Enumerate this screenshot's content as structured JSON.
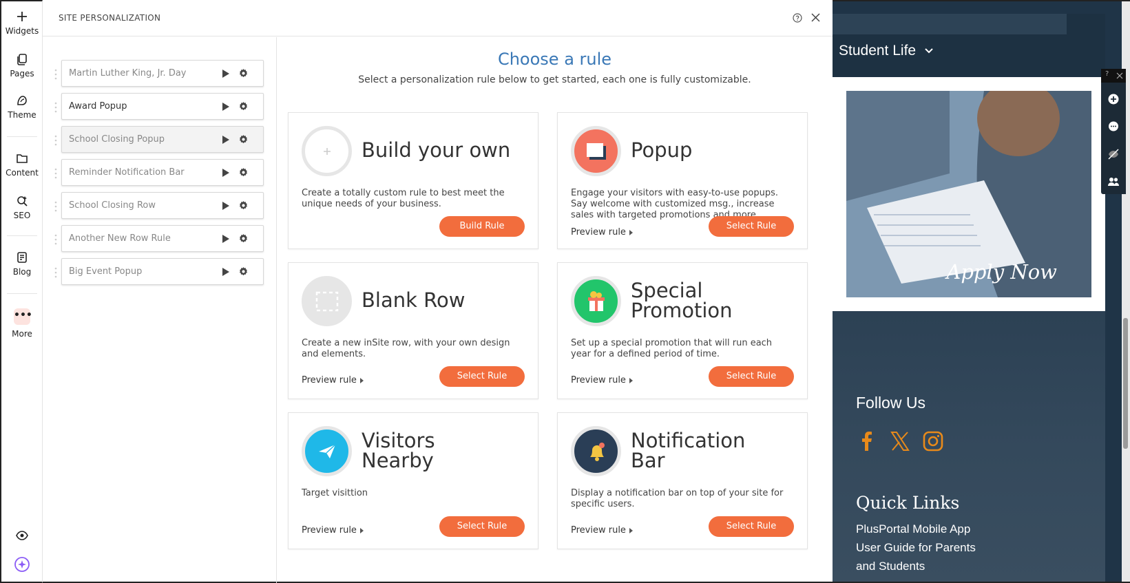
{
  "rail": {
    "items": [
      {
        "label": "Widgets",
        "icon": "plus-icon"
      },
      {
        "label": "Pages",
        "icon": "pages-icon"
      },
      {
        "label": "Theme",
        "icon": "theme-icon"
      },
      {
        "label": "Content",
        "icon": "folder-icon"
      },
      {
        "label": "SEO",
        "icon": "seo-icon"
      },
      {
        "label": "Blog",
        "icon": "blog-icon"
      },
      {
        "label": "More",
        "icon": "more-icon"
      }
    ]
  },
  "panel": {
    "title": "SITE PERSONALIZATION",
    "rules": [
      {
        "name": "Martin Luther King, Jr. Day"
      },
      {
        "name": "Award Popup"
      },
      {
        "name": "School Closing Popup"
      },
      {
        "name": "Reminder Notification Bar"
      },
      {
        "name": "School Closing Row"
      },
      {
        "name": "Another New Row Rule"
      },
      {
        "name": "Big Event Popup"
      }
    ],
    "heading": "Choose a rule",
    "subheading": "Select a personalization rule below to get started, each one is fully customizable.",
    "cards": [
      {
        "title": "Build your own",
        "desc": "Create a totally custom rule to best meet the unique needs of your business.",
        "button": "Build Rule",
        "preview": ""
      },
      {
        "title": "Popup",
        "desc": "Engage your visitors with easy-to-use popups. Say welcome with customized msg., increase sales with targeted promotions and more.",
        "button": "Select Rule",
        "preview": "Preview rule"
      },
      {
        "title": "Blank Row",
        "desc": "Create a new inSite row, with your own design and elements.",
        "button": "Select Rule",
        "preview": "Preview rule"
      },
      {
        "title": "Special Promotion",
        "title1": "Special",
        "title2": "Promotion",
        "desc": "Set up a special promotion that will run each year for a defined period of time.",
        "button": "Select Rule",
        "preview": "Preview rule"
      },
      {
        "title": "Visitors Nearby",
        "title1": "Visitors",
        "title2": "Nearby",
        "desc": "Target visittion",
        "button": "Select Rule",
        "preview": "Preview rule"
      },
      {
        "title": "Notification Bar",
        "title1": "Notification",
        "title2": "Bar",
        "desc": "Display a notification bar on top of your site for specific users.",
        "button": "Select Rule",
        "preview": "Preview rule"
      }
    ]
  },
  "site": {
    "nav_label": "Student Life",
    "apply": "Apply Now",
    "follow": "Follow Us",
    "quick_links": "Quick Links",
    "links": [
      "PlusPortal Mobile App",
      "User Guide for Parents",
      "and Students"
    ]
  },
  "colors": {
    "accent_button": "#f26d3d",
    "heading_blue": "#3a78b6",
    "popup_badge": "#f3735f",
    "promo_badge": "#22c56b",
    "nearby_badge": "#1fb8e8",
    "notification_badge": "#2a3e56",
    "social_orange": "#e88a1a"
  }
}
